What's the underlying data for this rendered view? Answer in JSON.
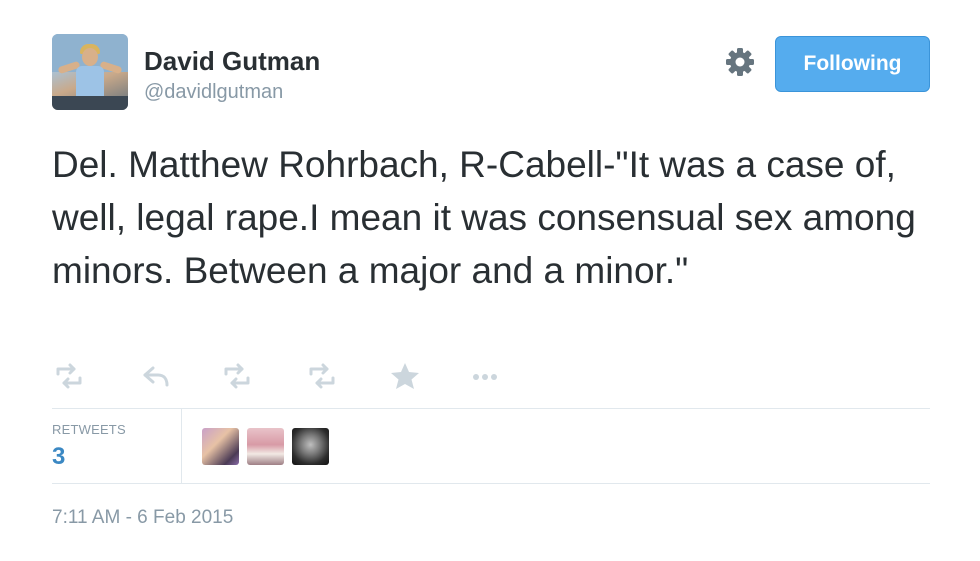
{
  "author": {
    "name": "David Gutman",
    "handle": "@davidlgutman"
  },
  "follow_button": {
    "label": "Following",
    "color": "#55acee"
  },
  "tweet": {
    "text": "Del. Matthew Rohrbach, R-Cabell-\"It was a case of, well, legal rape.I mean it was consensual sex among minors. Between a major and a minor.\""
  },
  "actions": [
    {
      "icon": "retweet-icon"
    },
    {
      "icon": "reply-icon"
    },
    {
      "icon": "retweet-icon"
    },
    {
      "icon": "retweet-icon"
    },
    {
      "icon": "star-icon"
    },
    {
      "icon": "more-icon"
    }
  ],
  "stats": {
    "retweets_label": "RETWEETS",
    "retweets_count": "3",
    "count_color": "#3b88c3"
  },
  "timestamp": "7:11 AM - 6 Feb 2015"
}
